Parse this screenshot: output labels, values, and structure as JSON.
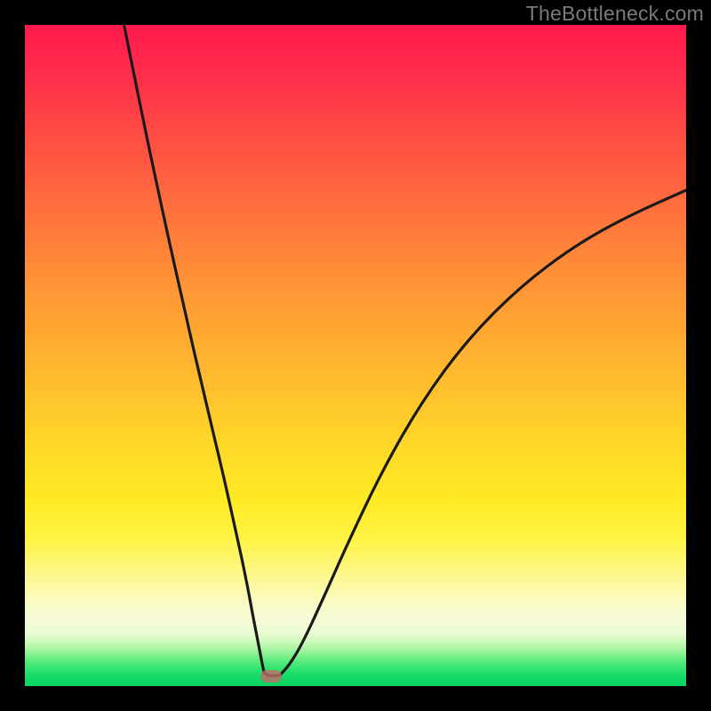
{
  "watermark": "TheBottleneck.com",
  "colors": {
    "frame": "#000000",
    "curve_stroke": "#1a1a1a",
    "marker_fill": "#c66a6a"
  },
  "chart_data": {
    "type": "line",
    "title": "",
    "xlabel": "",
    "ylabel": "",
    "xlim": [
      0,
      100
    ],
    "ylim": [
      0,
      100
    ],
    "grid": false,
    "legend": false,
    "marker": {
      "x": 37.2,
      "y": 1.5,
      "shape": "rounded-rect"
    },
    "series": [
      {
        "name": "left-branch",
        "x": [
          15,
          18,
          21,
          24,
          27,
          30,
          32,
          33.5,
          34.5,
          35.3,
          35.8,
          36.2
        ],
        "y": [
          100,
          85,
          71,
          57.5,
          44.5,
          32,
          23,
          16,
          10.5,
          6.5,
          3.8,
          2.0
        ]
      },
      {
        "name": "floor",
        "x": [
          36.2,
          36.8,
          37.6,
          38.6
        ],
        "y": [
          2.0,
          1.6,
          1.5,
          1.7
        ]
      },
      {
        "name": "right-branch",
        "x": [
          38.6,
          40,
          42,
          45,
          49,
          54,
          60,
          67,
          75,
          83,
          91,
          100
        ],
        "y": [
          1.7,
          3.2,
          6.5,
          13,
          22,
          32.5,
          43,
          52.5,
          60.5,
          66.5,
          71,
          75
        ]
      }
    ],
    "gradient_stops": [
      {
        "pos": 0,
        "color": "#ff1a4d"
      },
      {
        "pos": 36,
        "color": "#ff8a38"
      },
      {
        "pos": 72,
        "color": "#ffea24"
      },
      {
        "pos": 90,
        "color": "#f6fbd8"
      },
      {
        "pos": 100,
        "color": "#0cd463"
      }
    ]
  }
}
